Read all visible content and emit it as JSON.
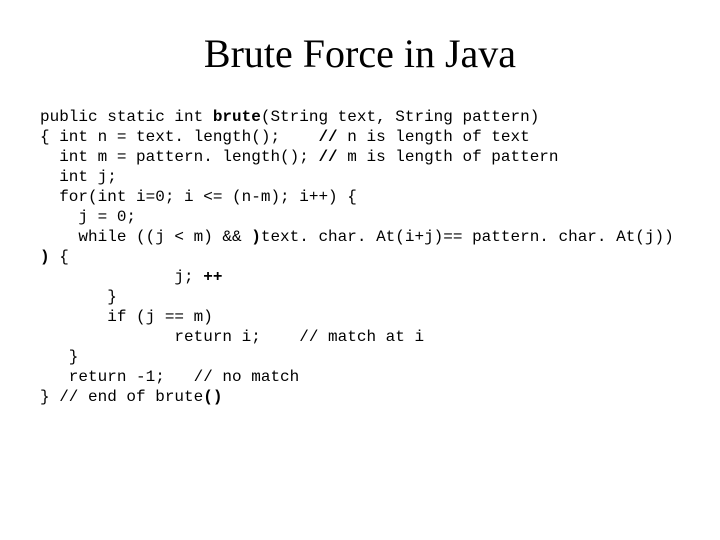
{
  "title": "Brute Force in Java",
  "code": {
    "l1a": "public static int ",
    "l1b": "brute",
    "l1c": "(String text, String pattern)",
    "l2a": "{ int n = text. length();    ",
    "l2b": "//",
    "l2c": " n is length of text",
    "l3a": "  int m = pattern. length(); ",
    "l3b": "//",
    "l3c": " m is length of pattern",
    "l4": "  int j;",
    "l5": "  for(int i=0; i <= (n-m); i++) {",
    "l6": "    j = 0;",
    "l7a": "    while ((j < m) && ",
    "l7b": ")",
    "l7c": "text. char. At(i+j)== pattern. char. At(j))",
    "l8a": ")",
    "l8b": " {",
    "l9a": "              j; ",
    "l9b": "++",
    "l10": "       }",
    "l11": "       if (j == m)",
    "l12": "              return i;    // match at i",
    "l13": "   }",
    "l14": "   return -1;   // no match",
    "l15a": "} // end of brute",
    "l15b": "()"
  }
}
